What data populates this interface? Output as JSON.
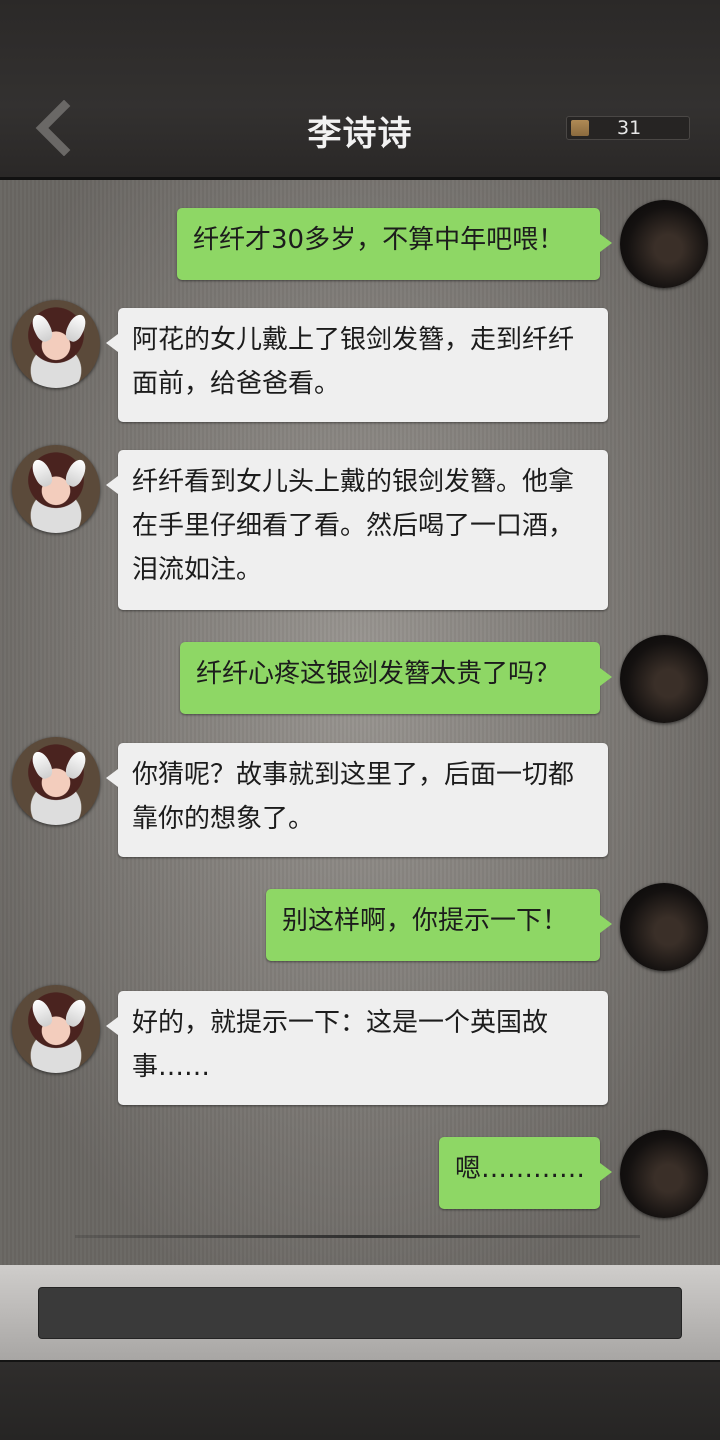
{
  "header": {
    "title": "李诗诗",
    "back_icon": "chevron-left-icon",
    "counter": {
      "icon": "coin-icon",
      "value": "31"
    }
  },
  "messages": [
    {
      "side": "right",
      "text": "纤纤才30多岁，不算中年吧喂！"
    },
    {
      "side": "left",
      "text": "阿花的女儿戴上了银剑发簪，走到纤纤面前，给爸爸看。"
    },
    {
      "side": "left",
      "text": "纤纤看到女儿头上戴的银剑发簪。他拿在手里仔细看了看。然后喝了一口酒，泪流如注。"
    },
    {
      "side": "right",
      "text": "纤纤心疼这银剑发簪太贵了吗？"
    },
    {
      "side": "left",
      "text": "你猜呢？故事就到这里了，后面一切都靠你的想象了。"
    },
    {
      "side": "right",
      "text": "别这样啊，你提示一下！"
    },
    {
      "side": "left",
      "text": "好的，就提示一下：这是一个英国故事……"
    },
    {
      "side": "right",
      "text": "嗯…………"
    }
  ],
  "input": {
    "placeholder": ""
  }
}
